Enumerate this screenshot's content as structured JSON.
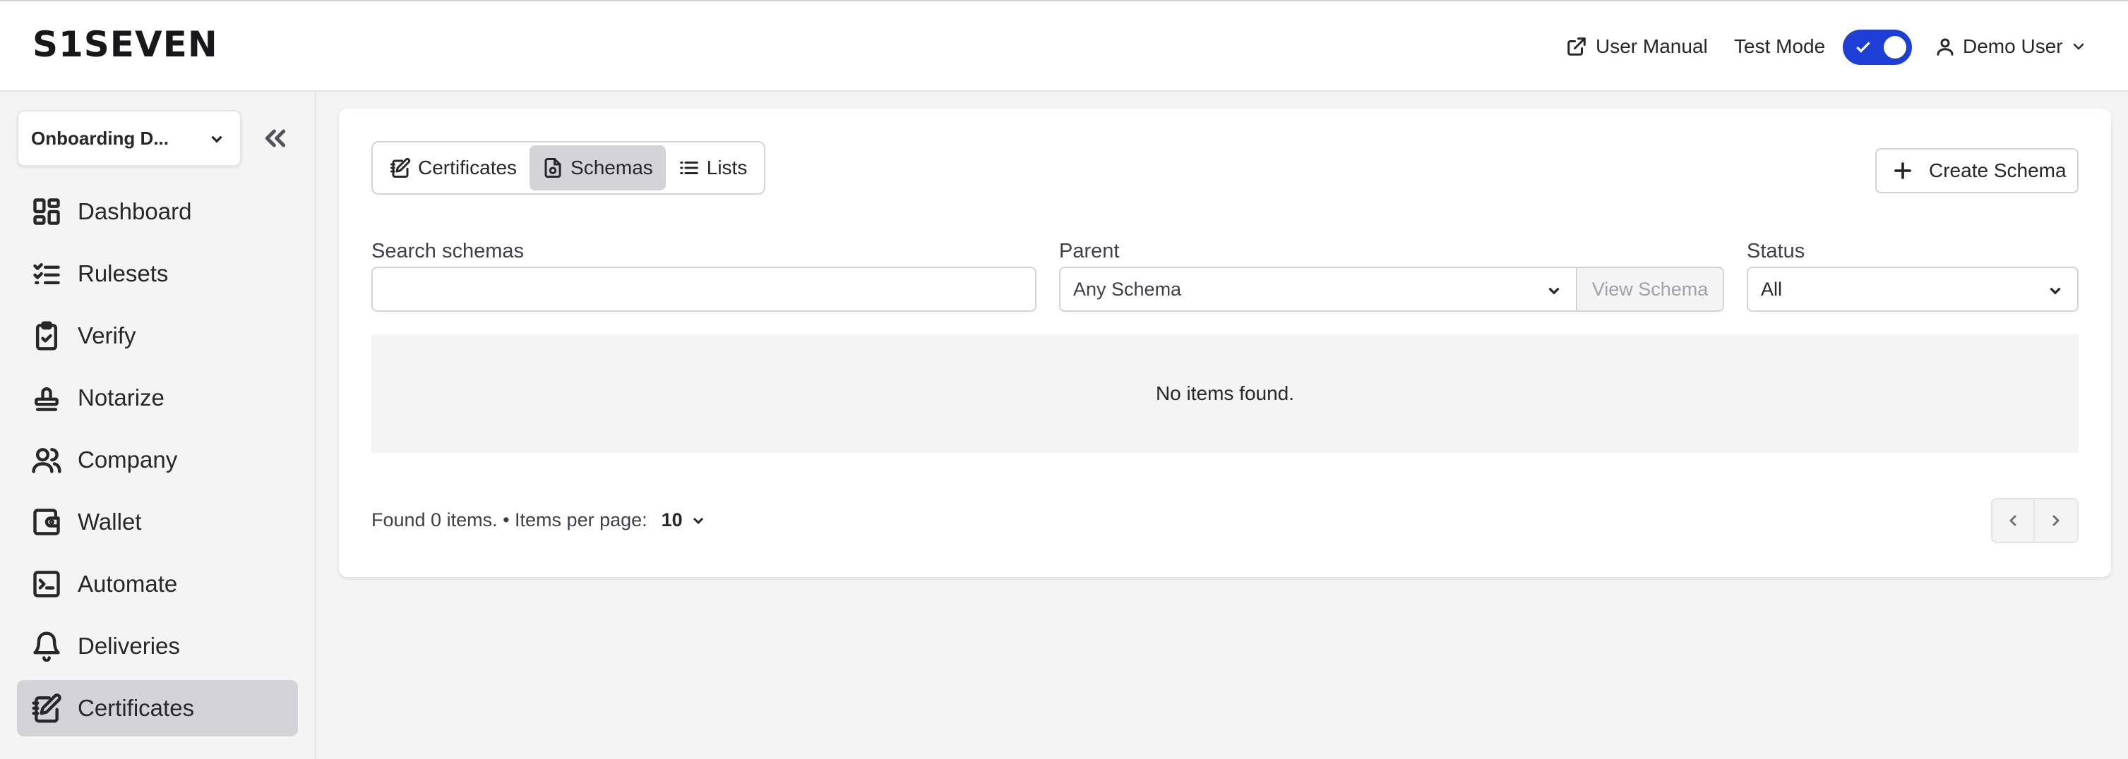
{
  "header": {
    "logo": "S1SEVEN",
    "user_manual": "User Manual",
    "test_mode_label": "Test Mode",
    "test_mode_on": true,
    "user_name": "Demo User"
  },
  "sidebar": {
    "org_select": "Onboarding D...",
    "items": [
      {
        "label": "Dashboard",
        "icon": "dashboard-icon"
      },
      {
        "label": "Rulesets",
        "icon": "list-check-icon"
      },
      {
        "label": "Verify",
        "icon": "clipboard-check-icon"
      },
      {
        "label": "Notarize",
        "icon": "stamp-icon"
      },
      {
        "label": "Company",
        "icon": "users-icon"
      },
      {
        "label": "Wallet",
        "icon": "wallet-icon"
      },
      {
        "label": "Automate",
        "icon": "terminal-icon"
      },
      {
        "label": "Deliveries",
        "icon": "bell-icon"
      },
      {
        "label": "Certificates",
        "icon": "certificate-edit-icon",
        "active": true
      }
    ]
  },
  "main": {
    "tabs": [
      {
        "label": "Certificates",
        "icon": "certificate-edit-icon"
      },
      {
        "label": "Schemas",
        "icon": "file-schema-icon",
        "active": true
      },
      {
        "label": "Lists",
        "icon": "list-icon"
      }
    ],
    "create_button": "Create Schema",
    "search": {
      "label": "Search schemas",
      "value": "",
      "placeholder": ""
    },
    "parent": {
      "label": "Parent",
      "value": "Any Schema",
      "view_button": "View Schema"
    },
    "status": {
      "label": "Status",
      "value": "All"
    },
    "empty_message": "No items found.",
    "footer": {
      "found_text": "Found 0 items. • Items per page:",
      "per_page": "10"
    }
  },
  "colors": {
    "accent": "#1d3fd6",
    "active_bg": "#d4d4d8",
    "page_bg": "#f4f4f5"
  }
}
